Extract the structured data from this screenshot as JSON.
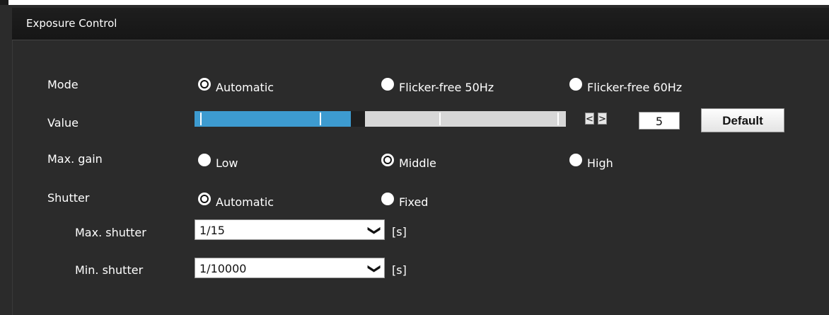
{
  "panel": {
    "title": "Exposure Control"
  },
  "mode": {
    "label": "Mode",
    "options": [
      {
        "label": "Automatic",
        "selected": true
      },
      {
        "label": "Flicker-free 50Hz",
        "selected": false
      },
      {
        "label": "Flicker-free 60Hz",
        "selected": false
      }
    ]
  },
  "value": {
    "label": "Value",
    "current": "5",
    "fill_fraction": 0.42,
    "prev_label": "<",
    "next_label": ">",
    "default_label": "Default",
    "colors": {
      "fill": "#3d9bd0",
      "track": "#d7d7d7"
    }
  },
  "max_gain": {
    "label": "Max. gain",
    "options": [
      {
        "label": "Low",
        "selected": false
      },
      {
        "label": "Middle",
        "selected": true
      },
      {
        "label": "High",
        "selected": false
      }
    ]
  },
  "shutter": {
    "label": "Shutter",
    "options": [
      {
        "label": "Automatic",
        "selected": true
      },
      {
        "label": "Fixed",
        "selected": false
      }
    ],
    "max": {
      "label": "Max. shutter",
      "value": "1/15",
      "unit": "[s]"
    },
    "min": {
      "label": "Min. shutter",
      "value": "1/10000",
      "unit": "[s]"
    }
  }
}
